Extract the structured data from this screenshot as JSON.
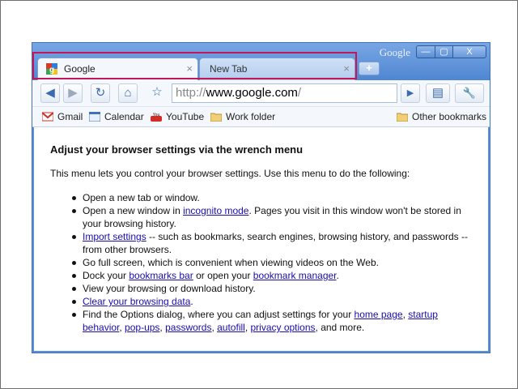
{
  "window": {
    "title_brand": "Google",
    "controls": {
      "minimize": "—",
      "maximize": "▢",
      "close": "X"
    }
  },
  "tabs": [
    {
      "label": "Google",
      "close": "×",
      "active": true
    },
    {
      "label": "New Tab",
      "close": "×",
      "active": false
    }
  ],
  "newtab": {
    "label": "+"
  },
  "toolbar": {
    "back": "◀",
    "forward": "▶",
    "reload": "↻",
    "home": "⌂",
    "star": "☆",
    "go": "▶",
    "page_menu": "▤",
    "wrench": "🔧",
    "url_scheme": "http://",
    "url_host": "www.google.com",
    "url_path": "/"
  },
  "bookmarks": {
    "items": [
      {
        "label": "Gmail",
        "icon": "gmail-icon"
      },
      {
        "label": "Calendar",
        "icon": "calendar-icon"
      },
      {
        "label": "YouTube",
        "icon": "youtube-icon"
      },
      {
        "label": "Work folder",
        "icon": "folder-icon"
      }
    ],
    "other": "Other bookmarks"
  },
  "content": {
    "heading": "Adjust your browser settings via the wrench menu",
    "intro": "This menu lets you control your browser settings. Use this menu to do the following:",
    "items": {
      "i1": "Open a new tab or window.",
      "i2_a": "Open a new window in ",
      "i2_link": "incognito mode",
      "i2_b": ". Pages you visit in this window won't be stored in your browsing history.",
      "i3_link": "Import settings",
      "i3_b": " -- such as bookmarks, search engines, browsing history, and passwords -- from other browsers.",
      "i4": "Go full screen, which is convenient when viewing videos on the Web.",
      "i5_a": "Dock your ",
      "i5_link1": "bookmarks bar",
      "i5_b": " or open your ",
      "i5_link2": "bookmark manager",
      "i5_c": ".",
      "i6": "View your browsing or download history.",
      "i7_link": "Clear your browsing data",
      "i7_b": ".",
      "i8_a": "Find the Options dialog, where you can adjust settings for your ",
      "i8_l1": "home page",
      "i8_s1": ", ",
      "i8_l2": "startup behavior",
      "i8_s2": ", ",
      "i8_l3": "pop-ups",
      "i8_s3": ", ",
      "i8_l4": "passwords",
      "i8_s4": ", ",
      "i8_l5": "autofill",
      "i8_s5": ", ",
      "i8_l6": "privacy options",
      "i8_b": ", and more."
    }
  },
  "colors": {
    "highlight": "#c2185b",
    "frame": "#5b8fd6",
    "link": "#1a0dab"
  }
}
